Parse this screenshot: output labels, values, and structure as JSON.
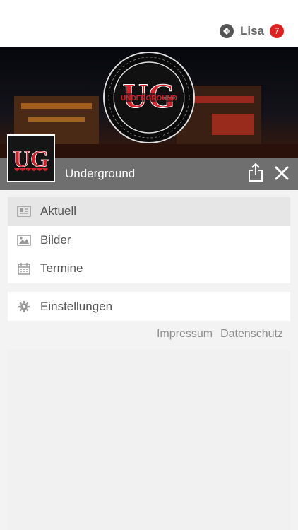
{
  "user": {
    "name": "Lisa",
    "badge": "7"
  },
  "page": {
    "title": "Underground"
  },
  "menu": {
    "items": [
      {
        "label": "Aktuell",
        "icon": "newspaper-icon",
        "active": true
      },
      {
        "label": "Bilder",
        "icon": "image-icon",
        "active": false
      },
      {
        "label": "Termine",
        "icon": "calendar-icon",
        "active": false
      }
    ],
    "settings_label": "Einstellungen"
  },
  "footer": {
    "impressum": "Impressum",
    "datenschutz": "Datenschutz"
  },
  "logo": {
    "initials": "UG",
    "brand": "UNDERGROUND",
    "ring_text": "METALKNEIPE · KONZERTE · UND MEHR · BIERGARTEN"
  },
  "colors": {
    "accent_red": "#d4202a",
    "badge_red": "#e02020",
    "titlebar": "#6f6f6f"
  }
}
